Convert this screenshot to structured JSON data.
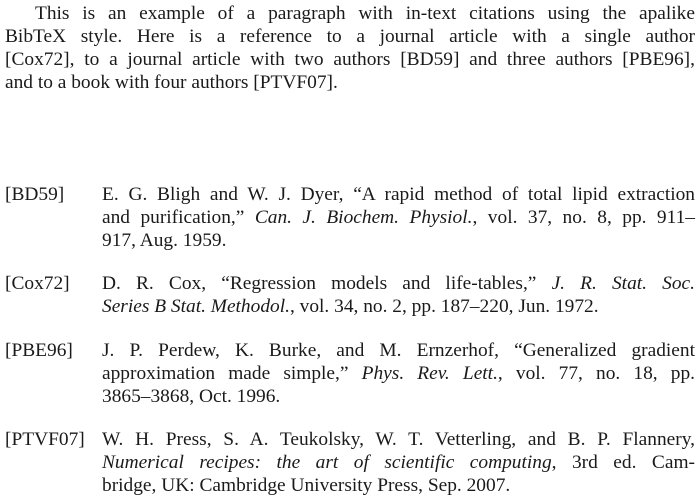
{
  "intro": {
    "lines": [
      "This is an example of a paragraph with in-text citations using the apalike",
      "BibTeX style.  Here is a reference to a journal article with a single author",
      "[Cox72], to a journal article with two authors [BD59] and three authors [PBE96],",
      "and to a book with four authors [PTVF07]."
    ]
  },
  "bibliography": [
    {
      "label": "[BD59]",
      "lines": [
        [
          {
            "t": "E. G. Bligh and W. J. Dyer, “A rapid method of total lipid extraction"
          }
        ],
        [
          {
            "t": "and purification,” "
          },
          {
            "t": "Can. J. Biochem. Physiol.",
            "i": true
          },
          {
            "t": ", vol. 37, no. 8, pp. 911–"
          }
        ],
        [
          {
            "t": "917, Aug. 1959."
          }
        ]
      ]
    },
    {
      "label": "[Cox72]",
      "lines": [
        [
          {
            "t": "D. R. Cox, “Regression models and life-tables,” "
          },
          {
            "t": "J. R. Stat. Soc.",
            "i": true
          }
        ],
        [
          {
            "t": "Series B Stat. Methodol.",
            "i": true
          },
          {
            "t": ", vol. 34, no. 2, pp. 187–220, Jun. 1972."
          }
        ]
      ]
    },
    {
      "label": "[PBE96]",
      "lines": [
        [
          {
            "t": "J. P. Perdew, K. Burke, and M. Ernzerhof, “Generalized gradient"
          }
        ],
        [
          {
            "t": "approximation made simple,” "
          },
          {
            "t": "Phys. Rev. Lett.",
            "i": true
          },
          {
            "t": ", vol. 77, no. 18, pp."
          }
        ],
        [
          {
            "t": "3865–3868, Oct. 1996."
          }
        ]
      ]
    },
    {
      "label": "[PTVF07]",
      "lines": [
        [
          {
            "t": "W. H. Press, S. A. Teukolsky, W. T. Vetterling, and B. P. Flannery,"
          }
        ],
        [
          {
            "t": "Numerical recipes: the art of scientific computing",
            "i": true
          },
          {
            "t": ", 3rd ed.   Cam-"
          }
        ],
        [
          {
            "t": "bridge, UK: Cambridge University Press, Sep. 2007."
          }
        ]
      ]
    }
  ]
}
